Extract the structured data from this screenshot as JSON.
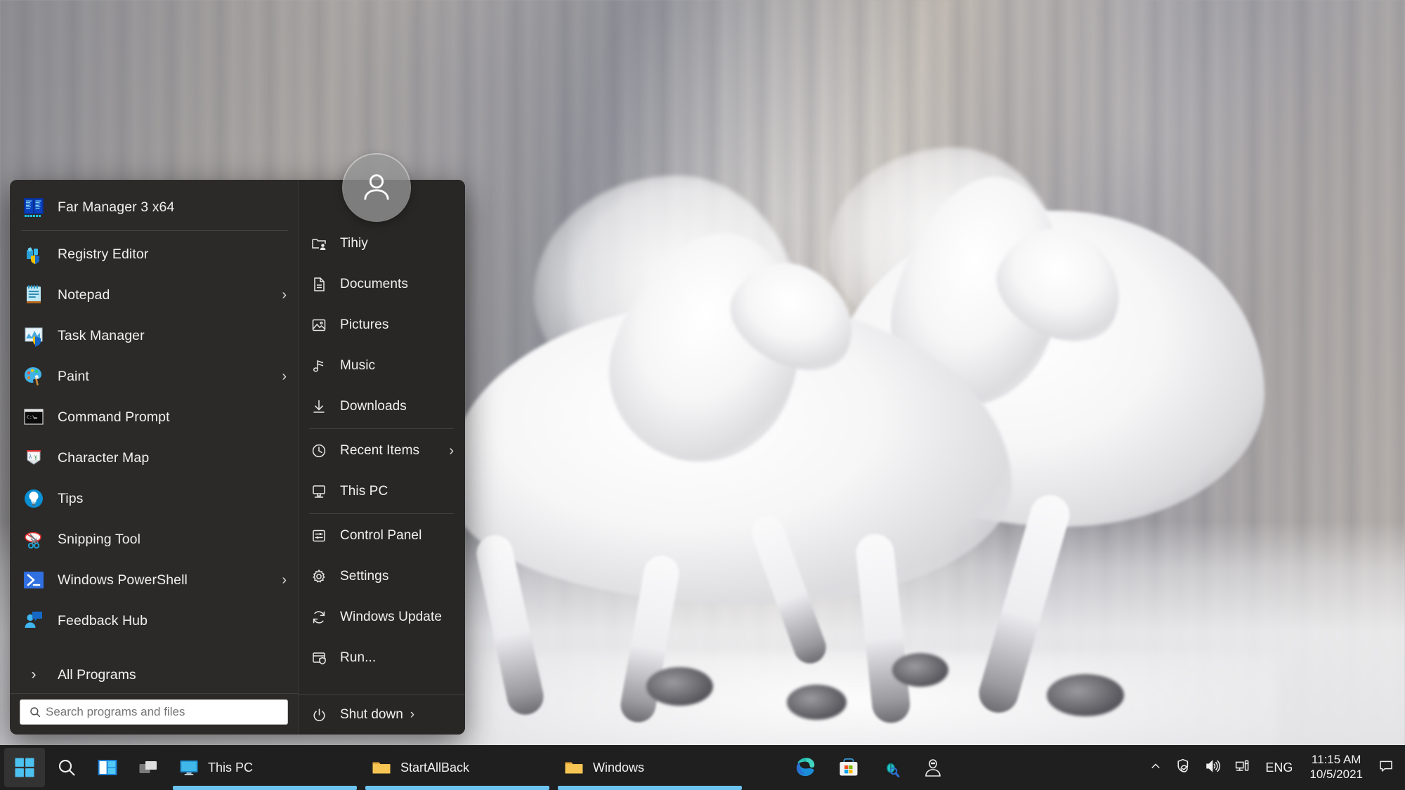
{
  "start_menu": {
    "avatar_icon": "user-avatar-icon",
    "left_items": [
      {
        "label": "Far Manager 3 x64",
        "icon": "far-manager-icon",
        "arrow": false
      },
      {
        "label": "Registry Editor",
        "icon": "registry-editor-icon",
        "arrow": false
      },
      {
        "label": "Notepad",
        "icon": "notepad-icon",
        "arrow": true
      },
      {
        "label": "Task Manager",
        "icon": "task-manager-icon",
        "arrow": false
      },
      {
        "label": "Paint",
        "icon": "paint-icon",
        "arrow": true
      },
      {
        "label": "Command Prompt",
        "icon": "command-prompt-icon",
        "arrow": false
      },
      {
        "label": "Character Map",
        "icon": "character-map-icon",
        "arrow": false
      },
      {
        "label": "Tips",
        "icon": "tips-icon",
        "arrow": false
      },
      {
        "label": "Snipping Tool",
        "icon": "snipping-tool-icon",
        "arrow": false
      },
      {
        "label": "Windows PowerShell",
        "icon": "powershell-icon",
        "arrow": true
      },
      {
        "label": "Feedback Hub",
        "icon": "feedback-hub-icon",
        "arrow": false
      }
    ],
    "all_programs_label": "All Programs",
    "all_programs_icon": "chevron-right-icon",
    "search": {
      "placeholder": "Search programs and files",
      "value": "",
      "icon": "search-icon"
    },
    "right_items": [
      {
        "label": "Tihiy",
        "icon": "user-folder-icon",
        "arrow": false
      },
      {
        "label": "Documents",
        "icon": "document-icon",
        "arrow": false
      },
      {
        "label": "Pictures",
        "icon": "picture-icon",
        "arrow": false
      },
      {
        "label": "Music",
        "icon": "music-note-icon",
        "arrow": false
      },
      {
        "label": "Downloads",
        "icon": "download-icon",
        "arrow": false
      },
      {
        "label": "Recent Items",
        "icon": "clock-icon",
        "arrow": true
      },
      {
        "label": "This PC",
        "icon": "monitor-icon",
        "arrow": false
      },
      {
        "label": "Control Panel",
        "icon": "control-panel-icon",
        "arrow": false
      },
      {
        "label": "Settings",
        "icon": "gear-icon",
        "arrow": false
      },
      {
        "label": "Windows Update",
        "icon": "refresh-icon",
        "arrow": false
      },
      {
        "label": "Run...",
        "icon": "run-icon",
        "arrow": false
      }
    ],
    "shutdown": {
      "label": "Shut down",
      "icon": "power-icon",
      "arrow_icon": "chevron-right-icon"
    }
  },
  "taskbar": {
    "start_button_icon": "windows-logo-icon",
    "search_icon": "search-icon",
    "task_view_icon": "task-view-icon",
    "widgets_icon": "widgets-icon",
    "windows": [
      {
        "label": "This PC",
        "icon": "this-pc-icon",
        "active": true
      },
      {
        "label": "StartAllBack",
        "icon": "folder-icon",
        "active": true
      },
      {
        "label": "Windows",
        "icon": "folder-icon",
        "active": true
      }
    ],
    "pinned": [
      {
        "name": "edge-icon"
      },
      {
        "name": "microsoft-store-icon"
      },
      {
        "name": "bug-magnifier-icon"
      },
      {
        "name": "person-icon"
      }
    ],
    "tray": {
      "overflow_icon": "chevron-up-icon",
      "security_icon": "security-check-icon",
      "volume_icon": "volume-icon",
      "network_icon": "network-icon",
      "language": "ENG",
      "time": "11:15 AM",
      "date": "10/5/2021",
      "notification_icon": "notification-icon"
    }
  },
  "colors": {
    "menu_bg": "#2b2a29",
    "menu_right_bg": "#282726",
    "taskbar_bg": "#1f1f1f",
    "accent_blue": "#6dc3f0",
    "windows_logo_blue": "#4cc2f1",
    "folder_yellow": "#f5c44a"
  }
}
